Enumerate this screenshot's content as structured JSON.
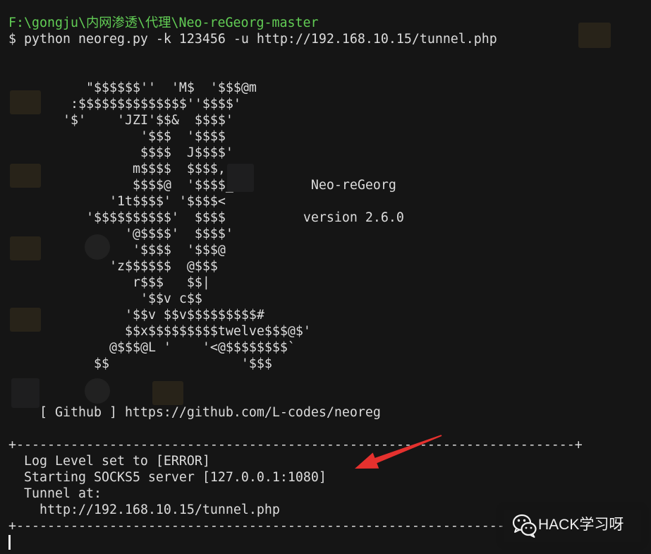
{
  "terminal": {
    "cwd_path": "F:\\gongju\\内网渗透\\代理\\Neo-reGeorg-master",
    "prompt": "$",
    "command": "python neoreg.py -k 123456 -u http://192.168.10.15/tunnel.php",
    "banner": {
      "art_lines": [
        "          \"$$$$$$''  'M$  '$$$@m",
        "        :$$$$$$$$$$$$$$''$$$$'",
        "       '$'    'JZI'$$&  $$$$'",
        "                 '$$$  '$$$$",
        "                 $$$$  J$$$$'",
        "                m$$$$  $$$$,",
        "                $$$$@  '$$$$_",
        "             '1t$$$$' '$$$$<",
        "          '$$$$$$$$$$'  $$$$",
        "               '@$$$$'  $$$$'",
        "                '$$$$  '$$$@",
        "             'z$$$$$$  @$$$",
        "                r$$$   $$|",
        "                 '$$v c$$",
        "               '$$v $$v$$$$$$$$$#",
        "               $$x$$$$$$$$$twelve$$$@$'",
        "             @$$$@L '    '<@$$$$$$$$`",
        "           $$                 '$$$"
      ],
      "title": "Neo-reGeorg",
      "version": "version 2.6.0"
    },
    "github": {
      "label": "[ Github ]",
      "url": "https://github.com/L-codes/neoreg"
    },
    "separator": "+------------------------------------------------------------------------+",
    "output": {
      "log_level": "Log Level set to [ERROR]",
      "socks_server": "Starting SOCKS5 server [127.0.0.1:1080]",
      "tunnel_label": "Tunnel at:",
      "tunnel_url": "http://192.168.10.15/tunnel.php"
    }
  },
  "annotation": {
    "icon": "arrow-icon"
  },
  "watermark": {
    "icon": "wechat-icon",
    "text": "HACK学习呀"
  },
  "colors": {
    "terminal_background": "#151515",
    "text": "#dcdcdc",
    "path_green": "#62cd55",
    "arrow_red": "#e5312e",
    "watermark_text": "#f2f2f2"
  }
}
